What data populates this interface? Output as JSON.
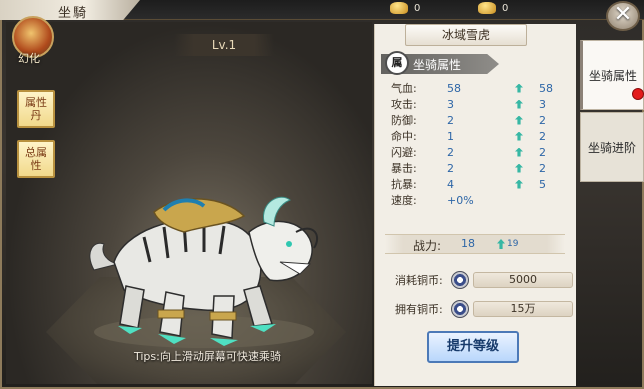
{
  "header": {
    "title": "坐騎"
  },
  "currency": [
    {
      "icon": "gold-ingot-icon",
      "amount": "0"
    },
    {
      "icon": "gold-ingot-icon",
      "amount": "0"
    }
  ],
  "close_label": "✕",
  "left": {
    "level": "Lv.1",
    "avatar_label": "幻化",
    "buttons": [
      {
        "label": "属性丹"
      },
      {
        "label": "总属性"
      }
    ],
    "tips": "Tips:向上滑动屏幕可快速乘骑"
  },
  "panel": {
    "mount_name": "冰域雪虎",
    "section_icon": "属",
    "section_title": "坐骑属性",
    "stats": [
      {
        "name": "气血:",
        "current": "58",
        "next": "58"
      },
      {
        "name": "攻击:",
        "current": "3",
        "next": "3"
      },
      {
        "name": "防御:",
        "current": "2",
        "next": "2"
      },
      {
        "name": "命中:",
        "current": "1",
        "next": "2"
      },
      {
        "name": "闪避:",
        "current": "2",
        "next": "2"
      },
      {
        "name": "暴击:",
        "current": "2",
        "next": "2"
      },
      {
        "name": "抗暴:",
        "current": "4",
        "next": "5"
      },
      {
        "name": "速度:",
        "current": "+0%",
        "next": ""
      }
    ],
    "power": {
      "label": "战力:",
      "current": "18",
      "next": "19"
    },
    "cost_label": "消耗铜币:",
    "cost_value": "5000",
    "owned_label": "拥有铜币:",
    "owned_value": "15万",
    "upgrade_button": "提升等级"
  },
  "tabs": [
    {
      "label": "坐骑属性",
      "active": true
    },
    {
      "label": "坐骑进阶",
      "active": false
    }
  ]
}
